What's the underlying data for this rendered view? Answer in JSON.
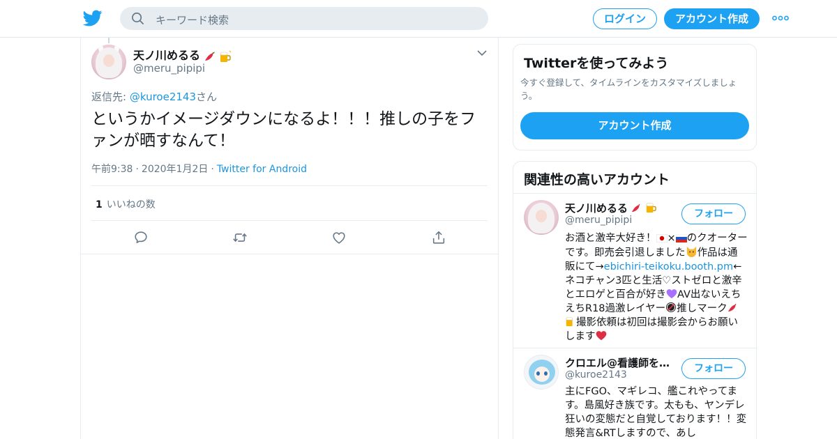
{
  "header": {
    "search_placeholder": "キーワード検索",
    "login_label": "ログイン",
    "signup_label": "アカウント作成",
    "brand_color": "#1da1f2"
  },
  "tweet": {
    "author_name": "天ノ川めるる",
    "author_handle": "@meru_pipipi",
    "reply_prefix": "返信先:",
    "reply_handle": "@kuroe2143",
    "reply_suffix": "さん",
    "text": "というかイメージダウンになるよ！！！推しの子をファンが晒すなんて！",
    "time": "午前9:38",
    "date": "2020年1月2日",
    "source": "Twitter for Android",
    "like_count": "1",
    "like_label": "いいねの数",
    "actions": [
      "reply-icon",
      "retweet-icon",
      "like-icon",
      "share-icon"
    ]
  },
  "sidebar": {
    "promo": {
      "title": "Twitterを使ってみよう",
      "description": "今すぐ登録して、タイムラインをカスタマイズしましょう。",
      "button": "アカウント作成"
    },
    "related": {
      "title": "関連性の高いアカウント",
      "follow_label": "フォロー",
      "accounts": [
        {
          "name": "天ノ川めるる",
          "handle": "@meru_pipipi",
          "bio_1": "お酒と激辛大好き！",
          "bio_2": "のクオーターです。即売会引退しました",
          "bio_3": "作品は通販にて→",
          "bio_link": "ebichiri-teikoku.booth.pm",
          "bio_4": "←ネコチャン3匹と生活♡ストゼロと激辛とエロゲと百合が好き",
          "bio_5": "AV出ないえちえちR18過激レイヤー",
          "bio_6": "推しマーク",
          "bio_7": "撮影依頼は初回は撮影会からお願いします"
        },
        {
          "name": "クロエル@看護師を…",
          "handle": "@kuroe2143",
          "bio": "主にFGO、マギレコ、艦これやってます。島風好き族です。太もも、ヤンデレ狂いの変態だと自覚しております！！変態発言&RTしますので、あし"
        }
      ]
    }
  }
}
